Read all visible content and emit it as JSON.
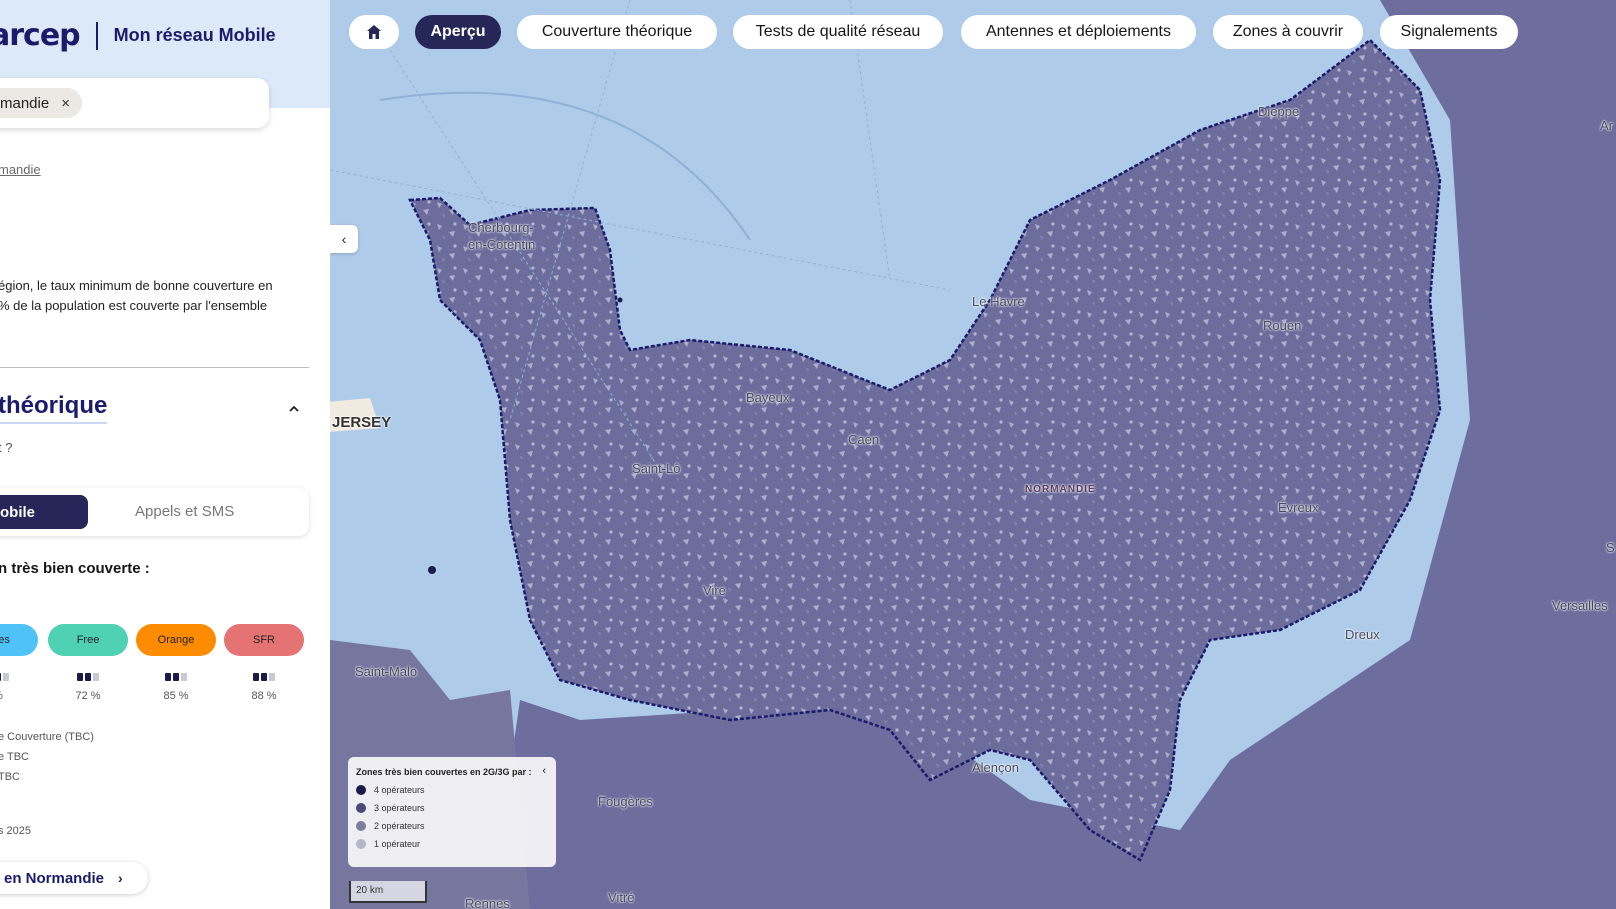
{
  "sidebar": {
    "brand": "arcep",
    "app_name": "Mon réseau Mobile",
    "search_chip": "mandie",
    "search_chip_close": "×",
    "breadcrumb": "mandie",
    "intro_line1": "égion, le taux minimum de bonne couverture en",
    "intro_line2": "% de la population est couverte par l'ensemble",
    "section_title": "théorique",
    "question": "t ?",
    "toggle_on": "obile",
    "toggle_off": "Appels et SMS",
    "subhead": "n très bien couverte :",
    "operators": [
      {
        "name": "gues",
        "pct": "%",
        "bars": 2,
        "color": "#4fc3f7"
      },
      {
        "name": "Free",
        "pct": "72 %",
        "bars": 2,
        "color": "#4fd1b4"
      },
      {
        "name": "Orange",
        "pct": "85 %",
        "bars": 2,
        "color": "#ff8c00"
      },
      {
        "name": "SFR",
        "pct": "88 %",
        "bars": 2,
        "color": "#e57373"
      }
    ],
    "legend_lines": [
      "e Couverture (TBC)",
      "e TBC",
      "TBC",
      "s 2025"
    ],
    "cta_label": "en Normandie",
    "cta_arrow": "›"
  },
  "map": {
    "nav": {
      "home_icon": "home-icon",
      "tabs": [
        {
          "label": "Aperçu",
          "active": true
        },
        {
          "label": "Couverture théorique",
          "active": false
        },
        {
          "label": "Tests de qualité réseau",
          "active": false
        },
        {
          "label": "Antennes et déploiements",
          "active": false
        },
        {
          "label": "Zones à couvrir",
          "active": false
        },
        {
          "label": "Signalements",
          "active": false
        }
      ]
    },
    "collapse_icon": "‹",
    "places": {
      "cherbourg1": "Cherbourg-",
      "cherbourg2": "en-Cotentin",
      "dieppe": "Dieppe",
      "lehavre": "Le Havre",
      "rouen": "Rouen",
      "bayeux": "Bayeux",
      "caen": "Caen",
      "saintlo": "Saint-Lô",
      "normandie": "NORMANDIE",
      "evreux": "Évreux",
      "jersey": "JERSEY",
      "vire": "Vire",
      "versailles": "Versailles",
      "dreux": "Dreux",
      "saintmalo": "Saint-Malo",
      "alencon": "Alençon",
      "fougeres": "Fougères",
      "vitre": "Vitré",
      "rennes": "Rennes",
      "ar": "Ar",
      "s": "S"
    },
    "legend": {
      "title": "Zones très bien couvertes en 2G/3G par :",
      "chevron": "‹",
      "items": [
        {
          "label": "4 opérateurs",
          "color": "#1b1b4b"
        },
        {
          "label": "3 opérateurs",
          "color": "#4a4a7a"
        },
        {
          "label": "2 opérateurs",
          "color": "#7d7d9c"
        },
        {
          "label": "1 opérateur",
          "color": "#b6b6c6"
        }
      ]
    },
    "scale": "20 km",
    "colors": {
      "sea": "#aecbe9",
      "coverage": "#6e6e9e",
      "border": "#1b1b6b"
    }
  }
}
